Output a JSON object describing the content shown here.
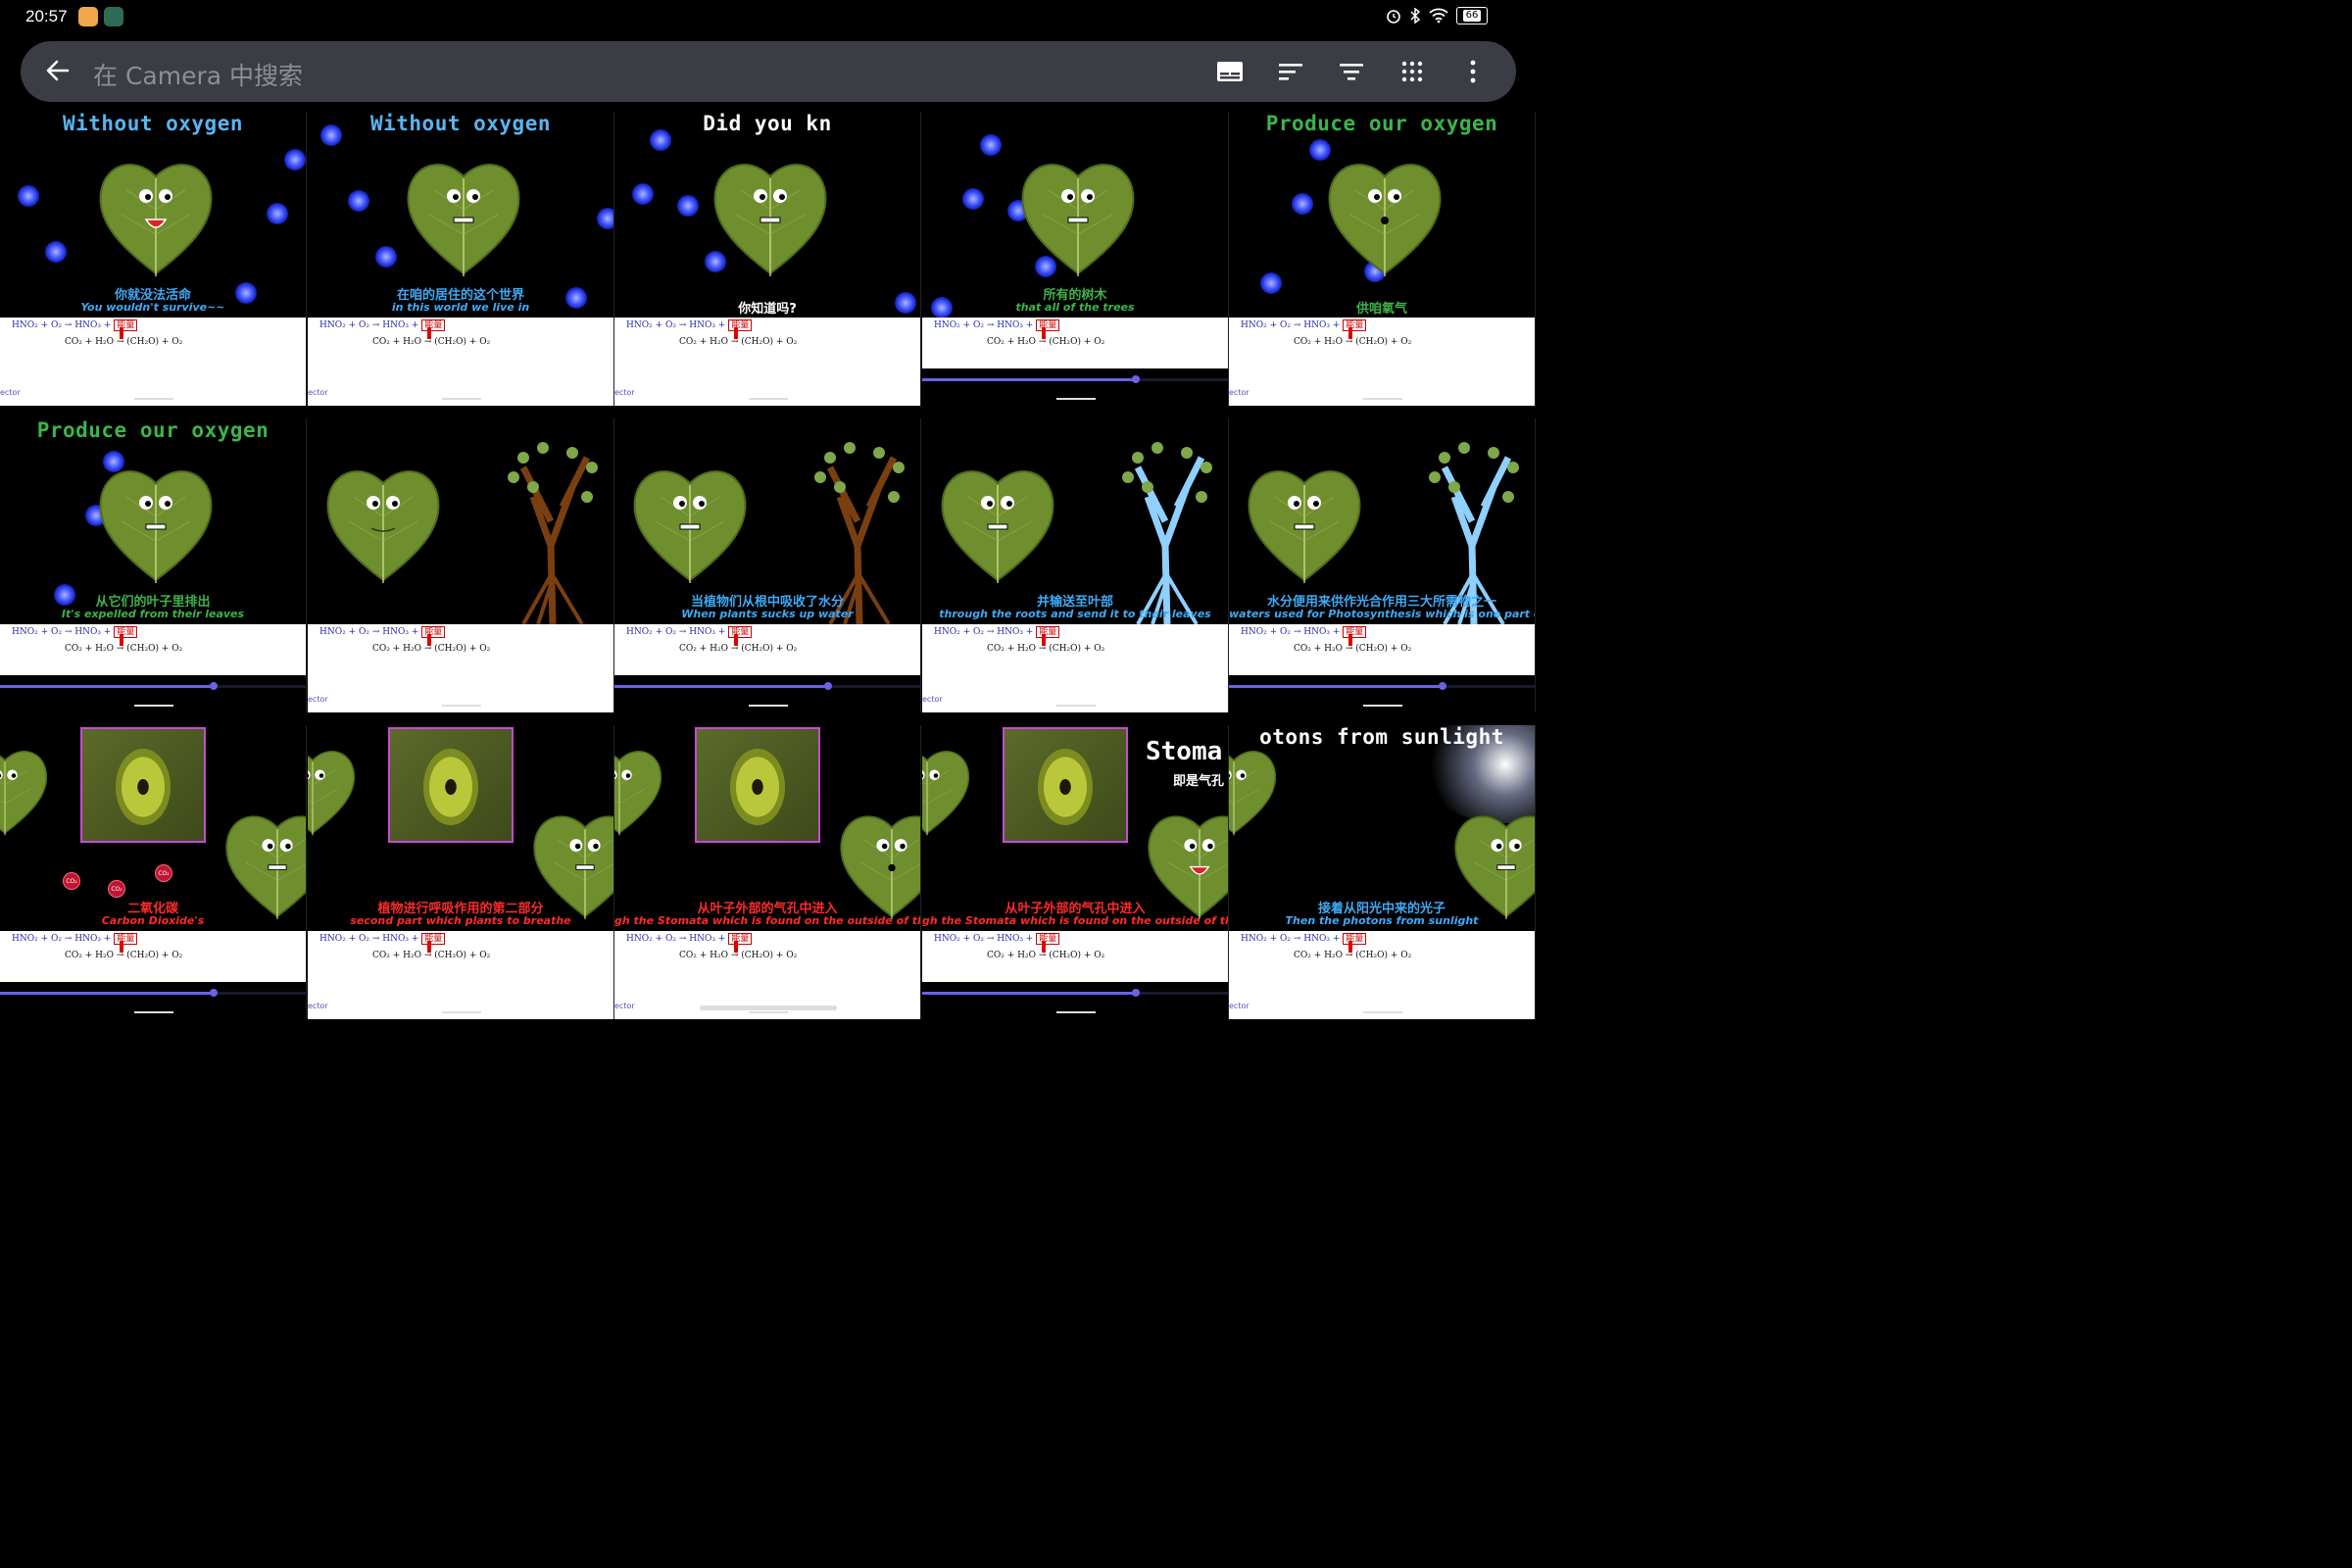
{
  "status": {
    "time": "20:57",
    "battery": "66",
    "icons": [
      "alarm-icon",
      "bluetooth-icon",
      "wifi-icon",
      "battery-icon"
    ]
  },
  "search": {
    "placeholder": "在 Camera 中搜索",
    "tools": [
      "subtitle-icon",
      "sort-icon",
      "filter-icon",
      "grid-icon",
      "more-vert-icon"
    ]
  },
  "slide": {
    "eq1": "HNO₂ + O₂ → HNO₃ + ",
    "energy": "能量",
    "eq2": "CO₂ + H₂O → (CH₂O) + O₂",
    "ector": "ector"
  },
  "thumbs": [
    {
      "title": "Without oxygen",
      "cn": "你就没法活命",
      "en": "You wouldn't survive~~",
      "progress": 0
    },
    {
      "title": "Without oxygen",
      "cn": "在咱的居住的这个世界",
      "en": "in this world we live in",
      "progress": 0
    },
    {
      "title": "Did you kn",
      "cn": "你知道吗?",
      "en": "",
      "progress": 0
    },
    {
      "title": "",
      "cn": "所有的树木",
      "en": "that all of the trees",
      "progress": 0.7
    },
    {
      "title": "Produce our oxygen",
      "cn": "供咱氧气",
      "en": "",
      "progress": 0
    },
    {
      "title": "Produce our oxygen",
      "cn": "从它们的叶子里排出",
      "en": "It's expelled from their leaves",
      "progress": 0.7
    },
    {
      "title": "",
      "cn": "",
      "en": "",
      "progress": 0
    },
    {
      "title": "",
      "cn": "当植物们从根中吸收了水分",
      "en": "When plants sucks up water",
      "progress": 0.7
    },
    {
      "title": "",
      "cn": "并输送至叶部",
      "en": "through the roots and send it to their leaves",
      "progress": 0
    },
    {
      "title": "",
      "cn": "水分便用来供作光合作用三大所需物之一",
      "en": "waters used for Photosynthesis which is one part of",
      "progress": 0.7
    },
    {
      "title": "",
      "cn": "二氧化碳",
      "en": "Carbon Dioxide's",
      "progress": 0.7
    },
    {
      "title": "",
      "cn": "植物进行呼吸作用的第二部分",
      "en": "second part which plants to breathe",
      "progress": 0
    },
    {
      "title": "",
      "cn": "从叶子外部的气孔中进入",
      "en": "gh the Stomata which is found on the outside of the",
      "progress": 0
    },
    {
      "title": "",
      "cn": "从叶子外部的气孔中进入",
      "en": "gh the Stomata which is found on the outside of the",
      "progress": 0.7
    },
    {
      "title": "otons from sunlight",
      "cn": "接着从阳光中来的光子",
      "en": "Then the photons from sunlight",
      "progress": 0
    }
  ],
  "labels": {
    "stoma": "Stoma",
    "stoma_cn": "即是气孔",
    "co2": "CO₂"
  },
  "colors": {
    "accent": "#6b63e6",
    "title_blue": "#5ab4f0",
    "title_green": "#3cb44a",
    "sub_cn_blue": "#3fa9f5",
    "sub_en_blue": "#3fa9f5",
    "sub_green": "#3cb44a",
    "sub_red": "#ff2a2a",
    "leaf": "#6f8f2e"
  }
}
